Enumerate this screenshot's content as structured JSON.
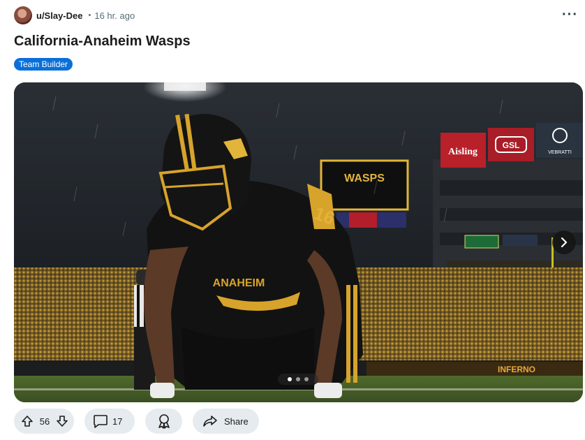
{
  "post": {
    "username": "u/Slay-Dee",
    "separator": "•",
    "time": "16 hr. ago",
    "title": "California-Anaheim Wasps",
    "flair": "Team Builder",
    "more_icon": "more-options-icon",
    "flair_color": "#0a6fd8"
  },
  "image": {
    "scoreboard_text": "WASPS",
    "banner_1": "Aisling",
    "banner_2": "GSL",
    "banner_3": "VEBRATTI",
    "jersey_text": "ANAHEIM",
    "jersey_number": "16",
    "sideline_text": "INFERNO",
    "carousel": {
      "total": 3,
      "active": 1
    },
    "team_colors": {
      "black": "#111111",
      "gold": "#d8a32b"
    }
  },
  "actions": {
    "upvotes": "56",
    "comments": "17",
    "share_label": "Share"
  }
}
